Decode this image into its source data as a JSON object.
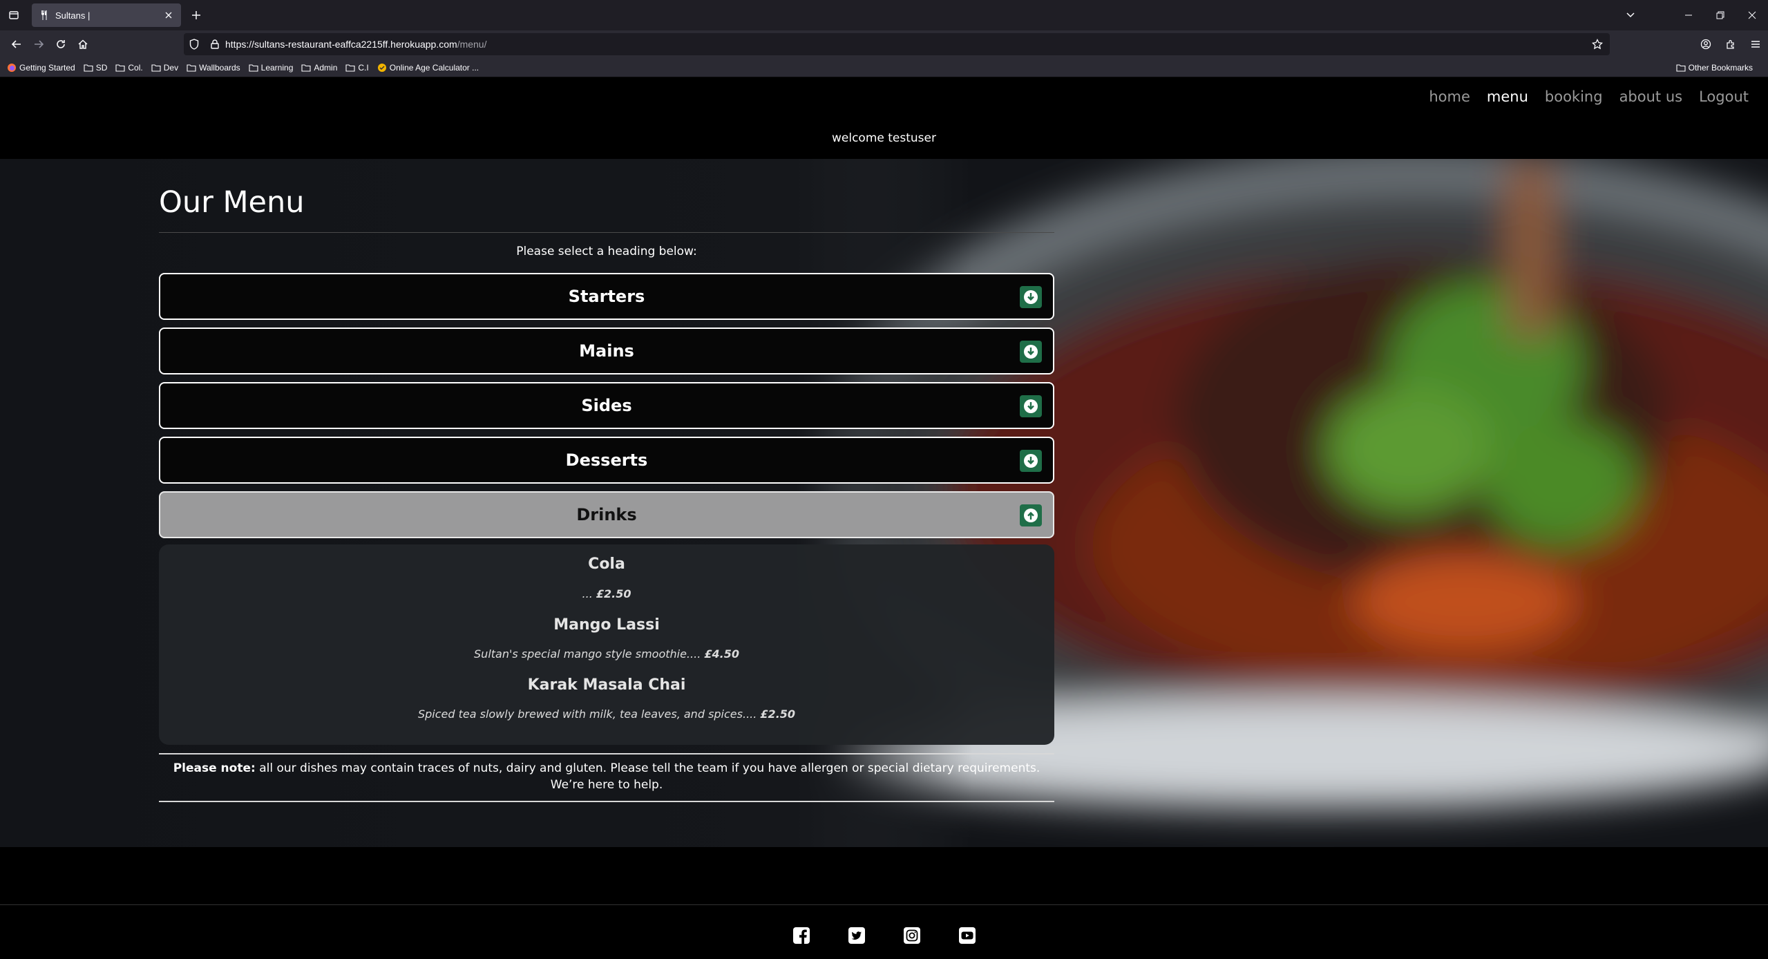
{
  "browser": {
    "tab": {
      "title": "Sultans |"
    },
    "url": {
      "host": "https://sultans-restaurant-eaffca2215ff.herokuapp.com",
      "path": "/menu/"
    },
    "bookmarks": [
      {
        "label": "Getting Started",
        "icon": "firefox-icon"
      },
      {
        "label": "SD",
        "icon": "folder-icon"
      },
      {
        "label": "Col.",
        "icon": "folder-icon"
      },
      {
        "label": "Dev",
        "icon": "folder-icon"
      },
      {
        "label": "Wallboards",
        "icon": "folder-icon"
      },
      {
        "label": "Learning",
        "icon": "folder-icon"
      },
      {
        "label": "Admin",
        "icon": "folder-icon"
      },
      {
        "label": "C.I",
        "icon": "folder-icon"
      },
      {
        "label": "Online Age Calculator ...",
        "icon": "calculator-icon"
      }
    ],
    "other_bookmarks": "Other Bookmarks"
  },
  "site": {
    "nav": [
      {
        "label": "home",
        "active": false
      },
      {
        "label": "menu",
        "active": true
      },
      {
        "label": "booking",
        "active": false
      },
      {
        "label": "about us",
        "active": false
      },
      {
        "label": "Logout",
        "active": false
      }
    ],
    "welcome": "welcome testuser"
  },
  "menu": {
    "title": "Our Menu",
    "instruction": "Please select a heading below:",
    "sections": [
      {
        "label": "Starters",
        "open": false
      },
      {
        "label": "Mains",
        "open": false
      },
      {
        "label": "Sides",
        "open": false
      },
      {
        "label": "Desserts",
        "open": false
      },
      {
        "label": "Drinks",
        "open": true
      }
    ],
    "drinks": [
      {
        "name": "Cola",
        "description": "...",
        "price": "£2.50"
      },
      {
        "name": "Mango Lassi",
        "description": "Sultan's special mango style smoothie....",
        "price": "£4.50"
      },
      {
        "name": "Karak Masala Chai",
        "description": "Spiced tea slowly brewed with milk, tea leaves, and spices....",
        "price": "£2.50"
      }
    ],
    "note": {
      "label": "Please note:",
      "text": "all our dishes may contain traces of nuts, dairy and gluten. Please tell the team if you have allergen or special dietary requirements. We’re here to help."
    }
  },
  "footer": {
    "social": [
      "facebook-icon",
      "twitter-icon",
      "instagram-icon",
      "youtube-icon"
    ]
  },
  "colors": {
    "accent_green": "#1f6e48",
    "open_section_bg": "#9a9a9b",
    "panel_bg": "#212428"
  }
}
